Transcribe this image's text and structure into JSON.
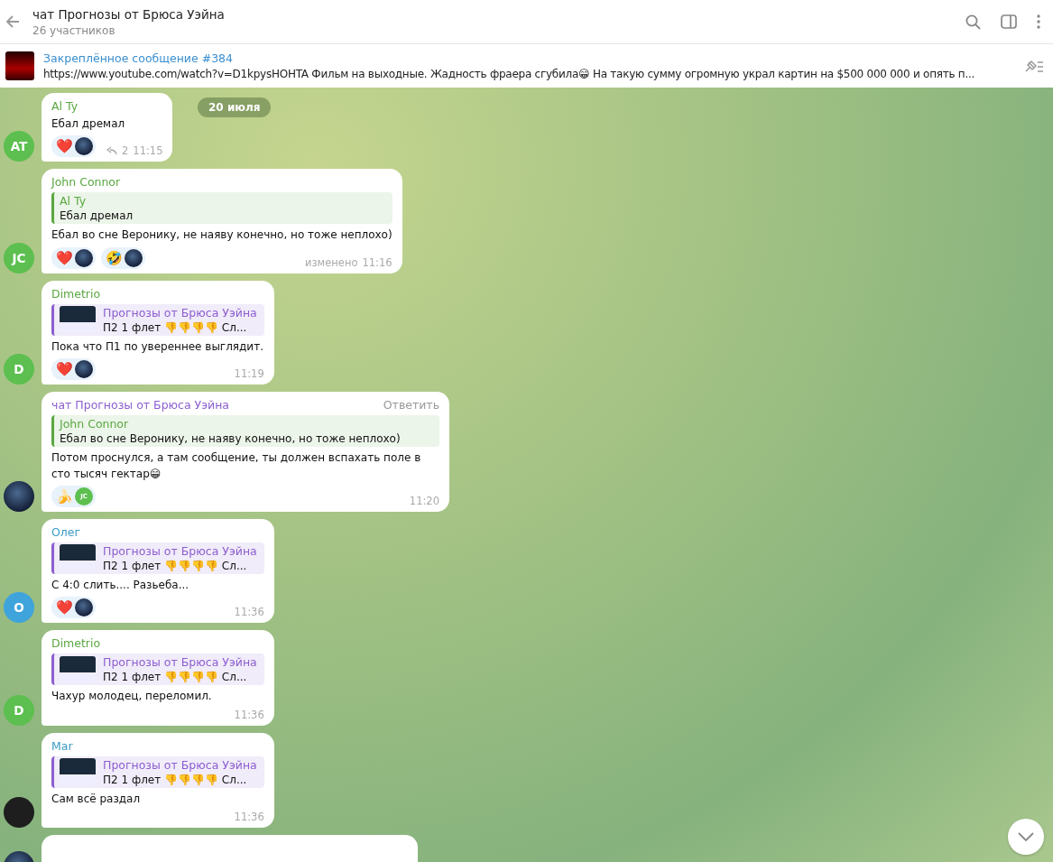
{
  "header": {
    "title": "чат Прогнозы от Брюса Уэйна",
    "subtitle": "26 участников"
  },
  "pinned": {
    "title": "Закреплённое сообщение #384",
    "text": "https://www.youtube.com/watch?v=D1kpysHOHTA  Фильм на выходные.  Жадность фраера сгубила😁  На такую сумму огромную украл картин на $500 000 000 и опять п..."
  },
  "date_badge": "20 июля",
  "messages": [
    {
      "avatar": {
        "kind": "initials",
        "initials": "AT",
        "color": "#5cbf4f"
      },
      "sender": "Al Ty",
      "color": "#5aa842",
      "text": "Ебал дремал",
      "reactions": [
        {
          "emoji": "❤️",
          "avatar": {
            "kind": "photo"
          }
        }
      ],
      "forwards": "2",
      "time": "11:15"
    },
    {
      "avatar": {
        "kind": "initials",
        "initials": "JC",
        "color": "#5cbf4f"
      },
      "sender": "John Connor",
      "color": "#5aa842",
      "reply": {
        "kind": "quote",
        "name": "Al Ty",
        "text": "Ебал дремал",
        "color": "#5aa842"
      },
      "text": "Ебал во сне Веронику, не наяву конечно, но тоже неплохо)",
      "reactions": [
        {
          "emoji": "❤️",
          "avatar": {
            "kind": "photo"
          }
        },
        {
          "emoji": "🤣",
          "avatar": {
            "kind": "photo"
          }
        }
      ],
      "edited": "изменено",
      "time": "11:16"
    },
    {
      "avatar": {
        "kind": "initials",
        "initials": "D",
        "color": "#5cbf4f"
      },
      "sender": "Dimetrio",
      "color": "#5aa842",
      "reply": {
        "kind": "forward",
        "name": "Прогнозы от Брюса Уэйна",
        "text": "П2 1 флет 👎👎👎👎 Сл...",
        "color": "#8c5fd0"
      },
      "text": "Пока что П1 по увереннее выглядит.",
      "reactions": [
        {
          "emoji": "❤️",
          "avatar": {
            "kind": "photo"
          }
        }
      ],
      "time": "11:19"
    },
    {
      "avatar": {
        "kind": "photo"
      },
      "sender": "чат Прогнозы от Брюса Уэйна",
      "color": "#8c5fd0",
      "action": "Ответить",
      "reply": {
        "kind": "quote",
        "name": "John Connor",
        "text": "Ебал во сне Веронику, не наяву конечно, но тоже неплохо)",
        "color": "#5aa842"
      },
      "text": "Потом проснулся, а там сообщение, ты должен вспахать поле в сто тысяч гектар😁",
      "reactions": [
        {
          "emoji": "🍌",
          "avatar": {
            "kind": "initials",
            "initials": "JC"
          }
        }
      ],
      "time": "11:20"
    },
    {
      "avatar": {
        "kind": "initials",
        "initials": "O",
        "color": "#3fa4dc"
      },
      "sender": "Олег",
      "color": "#3a9bc6",
      "reply": {
        "kind": "forward",
        "name": "Прогнозы от Брюса Уэйна",
        "text": "П2 1 флет 👎👎👎👎 Сл...",
        "color": "#8c5fd0"
      },
      "text": "С 4:0 слить.... Разьеба...",
      "reactions": [
        {
          "emoji": "❤️",
          "avatar": {
            "kind": "photo"
          }
        }
      ],
      "time": "11:36"
    },
    {
      "avatar": {
        "kind": "initials",
        "initials": "D",
        "color": "#5cbf4f"
      },
      "sender": "Dimetrio",
      "color": "#5aa842",
      "reply": {
        "kind": "forward",
        "name": "Прогнозы от Брюса Уэйна",
        "text": "П2 1 флет 👎👎👎👎 Сл...",
        "color": "#8c5fd0"
      },
      "text": "Чахур молодец, переломил.",
      "time": "11:36"
    },
    {
      "avatar": {
        "kind": "blank"
      },
      "sender": "Mar",
      "color": "#3a9bc6",
      "reply": {
        "kind": "forward",
        "name": "Прогнозы от Брюса Уэйна",
        "text": "П2 1 флет 👎👎👎👎 Сл...",
        "color": "#8c5fd0"
      },
      "text": "Сам всё раздал",
      "time": "11:36"
    },
    {
      "avatar": {
        "kind": "photo"
      },
      "partial": true
    }
  ]
}
